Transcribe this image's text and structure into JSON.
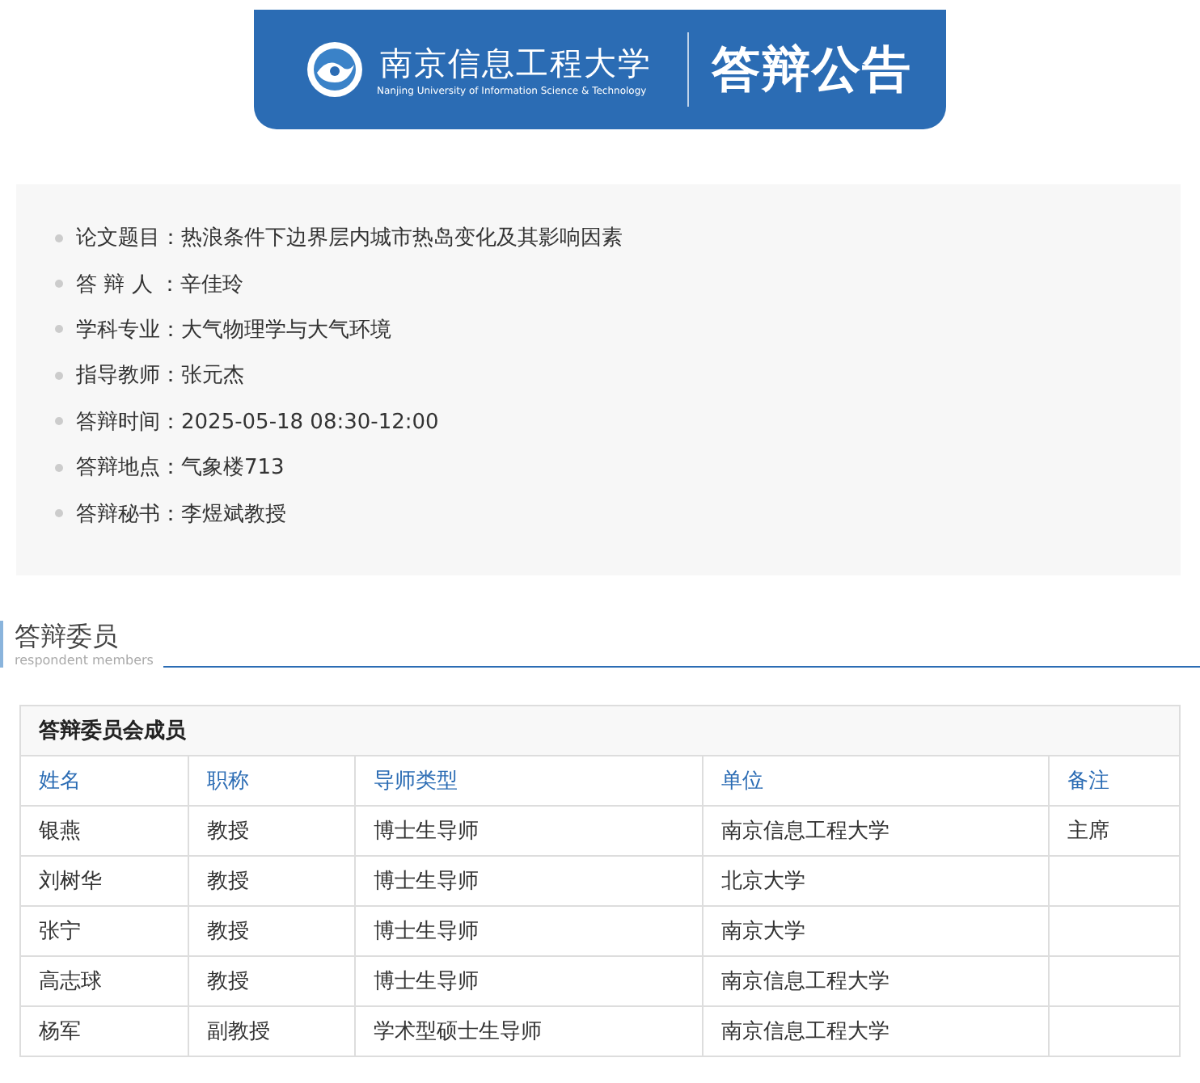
{
  "banner": {
    "school_name": "南京信息工程大学",
    "school_name_en": "Nanjing University of Information Science & Technology",
    "title": "答辩公告"
  },
  "info": [
    {
      "label": "论文题目：",
      "value": "热浪条件下边界层内城市热岛变化及其影响因素"
    },
    {
      "label": "答 辩 人 ：",
      "value": "辛佳玲"
    },
    {
      "label": "学科专业：",
      "value": "大气物理学与大气环境"
    },
    {
      "label": "指导教师：",
      "value": "张元杰"
    },
    {
      "label": "答辩时间：",
      "value": "2025-05-18 08:30-12:00"
    },
    {
      "label": "答辩地点：",
      "value": "气象楼713"
    },
    {
      "label": "答辩秘书：",
      "value": "李煜斌教授"
    }
  ],
  "section": {
    "title": "答辩委员",
    "subtitle": "respondent members"
  },
  "table": {
    "caption": "答辩委员会成员",
    "columns": [
      "姓名",
      "职称",
      "导师类型",
      "单位",
      "备注"
    ],
    "rows": [
      [
        "银燕",
        "教授",
        "博士生导师",
        "南京信息工程大学",
        "主席"
      ],
      [
        "刘树华",
        "教授",
        "博士生导师",
        "北京大学",
        ""
      ],
      [
        "张宁",
        "教授",
        "博士生导师",
        "南京大学",
        ""
      ],
      [
        "高志球",
        "教授",
        "博士生导师",
        "南京信息工程大学",
        ""
      ],
      [
        "杨军",
        "副教授",
        "学术型硕士生导师",
        "南京信息工程大学",
        ""
      ]
    ]
  }
}
